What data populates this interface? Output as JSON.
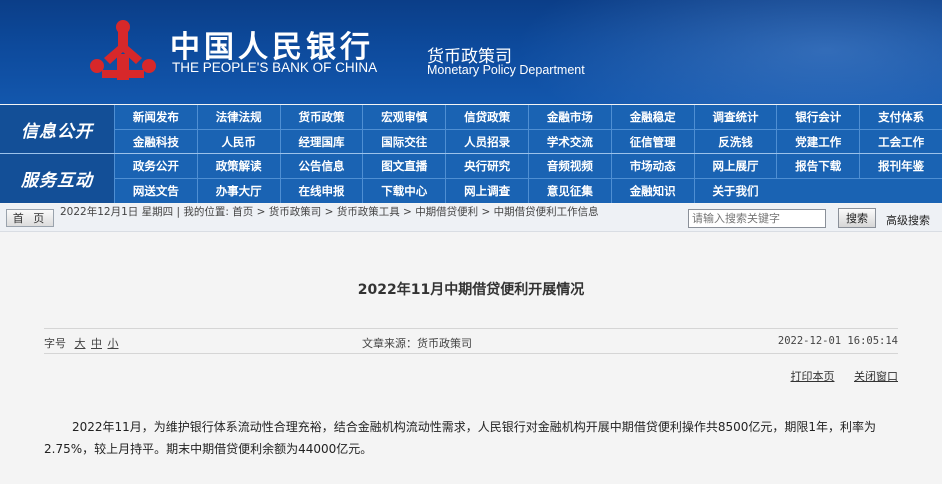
{
  "header": {
    "bank_name_cn": "中国人民银行",
    "bank_name_en": "THE PEOPLE'S BANK OF CHINA",
    "dept_cn": "货币政策司",
    "dept_en": "Monetary Policy Department"
  },
  "nav_info": {
    "title": "信息公开",
    "items": [
      "新闻发布",
      "法律法规",
      "货币政策",
      "宏观审慎",
      "信贷政策",
      "金融市场",
      "金融稳定",
      "调查统计",
      "银行会计",
      "支付体系",
      "金融科技",
      "人民币",
      "经理国库",
      "国际交往",
      "人员招录",
      "学术交流",
      "征信管理",
      "反洗钱",
      "党建工作",
      "工会工作"
    ]
  },
  "nav_service": {
    "title": "服务互动",
    "items": [
      "政务公开",
      "政策解读",
      "公告信息",
      "图文直播",
      "央行研究",
      "音频视频",
      "市场动态",
      "网上展厅",
      "报告下载",
      "报刊年鉴",
      "网送文告",
      "办事大厅",
      "在线申报",
      "下载中心",
      "网上调查",
      "意见征集",
      "金融知识",
      "关于我们"
    ]
  },
  "location": {
    "home_label": "首 页",
    "date": "2022年12月1日",
    "weekday": "星期四",
    "prefix": "我的位置:",
    "crumbs": [
      "首页",
      "货币政策司",
      "货币政策工具",
      "中期借贷便利",
      "中期借贷便利工作信息"
    ]
  },
  "search": {
    "placeholder": "请输入搜索关键字",
    "button_label": "搜索",
    "advanced_label": "高级搜索"
  },
  "article": {
    "title": "2022年11月中期借贷便利开展情况",
    "fontsize_label": "字号",
    "fontsize_options": [
      "大",
      "中",
      "小"
    ],
    "source": "文章来源：货币政策司",
    "date": "2022-12-01 16:05:14",
    "print_label": "打印本页",
    "close_label": "关闭窗口",
    "body": "2022年11月，为维护银行体系流动性合理充裕，结合金融机构流动性需求，人民银行对金融机构开展中期借贷便利操作共8500亿元，期限1年，利率为2.75%，较上月持平。期末中期借贷便利余额为44000亿元。"
  },
  "colors": {
    "banner": "#0d4a9c",
    "nav": "#1a63b3",
    "nav_title": "#134f97",
    "emblem": "#d7282a"
  }
}
